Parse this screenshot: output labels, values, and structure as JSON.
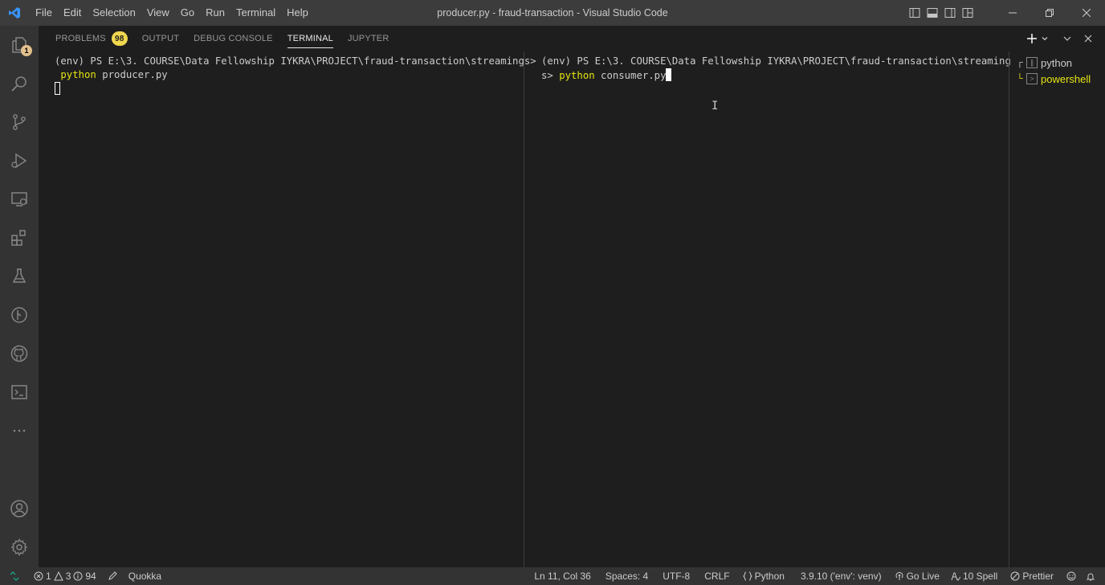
{
  "window": {
    "title": "producer.py - fraud-transaction - Visual Studio Code"
  },
  "menu": [
    "File",
    "Edit",
    "Selection",
    "View",
    "Go",
    "Run",
    "Terminal",
    "Help"
  ],
  "activity_bar": {
    "explorer_badge": "1",
    "items": [
      "explorer-icon",
      "search-icon",
      "source-control-icon",
      "run-debug-icon",
      "remote-explorer-icon",
      "extensions-icon",
      "testing-icon",
      "git-graph-icon",
      "github-icon",
      "terminal-icon",
      "more-icon",
      "account-icon",
      "settings-gear-icon"
    ]
  },
  "panel": {
    "tabs": [
      {
        "label": "PROBLEMS",
        "badge": "98"
      },
      {
        "label": "OUTPUT"
      },
      {
        "label": "DEBUG CONSOLE"
      },
      {
        "label": "TERMINAL",
        "active": true
      },
      {
        "label": "JUPYTER"
      }
    ]
  },
  "terminal_left": {
    "line1": "(env) PS E:\\3. COURSE\\Data Fellowship IYKRA\\PROJECT\\fraud-transaction\\streamings>",
    "cmd_keyword": "python",
    "cmd_args": " producer.py"
  },
  "terminal_right": {
    "line1": "(env) PS E:\\3. COURSE\\Data Fellowship IYKRA\\PROJECT\\fraud-transaction\\streaming",
    "line2_prefix": "s> ",
    "cmd_keyword": "python",
    "cmd_args": " consumer.py"
  },
  "terminal_list": [
    {
      "label": "python",
      "tree": "┌"
    },
    {
      "label": "powershell",
      "tree": "└",
      "active": true
    }
  ],
  "statusbar": {
    "errors": "1",
    "warnings": "3",
    "infos": "94",
    "quokka": "Quokka",
    "position": "Ln 11, Col 36",
    "spaces": "Spaces: 4",
    "encoding": "UTF-8",
    "eol": "CRLF",
    "language": "Python",
    "interpreter": "3.9.10 ('env': venv)",
    "golive": "Go Live",
    "spell": "10 Spell",
    "prettier": "Prettier"
  },
  "colors": {
    "accent_yellow": "#e5e510",
    "badge_yellow": "#f0d74e",
    "vscode_blue": "#3794ff"
  }
}
